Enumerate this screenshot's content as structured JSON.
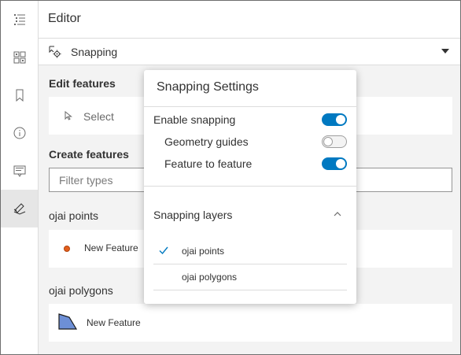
{
  "header": {
    "title": "Editor"
  },
  "rail": {
    "items": [
      {
        "icon": "layer-list-icon",
        "active": false
      },
      {
        "icon": "basemap-gallery-icon",
        "active": false
      },
      {
        "icon": "bookmark-icon",
        "active": false
      },
      {
        "icon": "information-icon",
        "active": false
      },
      {
        "icon": "legend-icon",
        "active": false
      },
      {
        "icon": "editor-icon",
        "active": true
      }
    ]
  },
  "snapping_bar": {
    "label": "Snapping",
    "icon": "snapping-icon"
  },
  "edit_features": {
    "title": "Edit features",
    "select_label": "Select"
  },
  "create_features": {
    "title": "Create features",
    "filter_placeholder": "Filter types"
  },
  "groups": [
    {
      "title": "ojai points",
      "feature_label": "New Feature",
      "symbol": "point",
      "symbol_color": "#e35f1c"
    },
    {
      "title": "ojai polygons",
      "feature_label": "New Feature",
      "symbol": "polygon",
      "symbol_color": "#6d8fd6"
    }
  ],
  "snapping_settings": {
    "title": "Snapping Settings",
    "toggles": [
      {
        "label": "Enable snapping",
        "on": true
      },
      {
        "label": "Geometry guides",
        "on": false
      },
      {
        "label": "Feature to feature",
        "on": true
      }
    ],
    "layers_title": "Snapping layers",
    "layers": [
      {
        "label": "ojai points",
        "checked": true
      },
      {
        "label": "ojai polygons",
        "checked": false
      }
    ]
  },
  "colors": {
    "accent": "#0079c1",
    "border": "#dcdcdc",
    "panel_bg": "#f3f3f3"
  }
}
